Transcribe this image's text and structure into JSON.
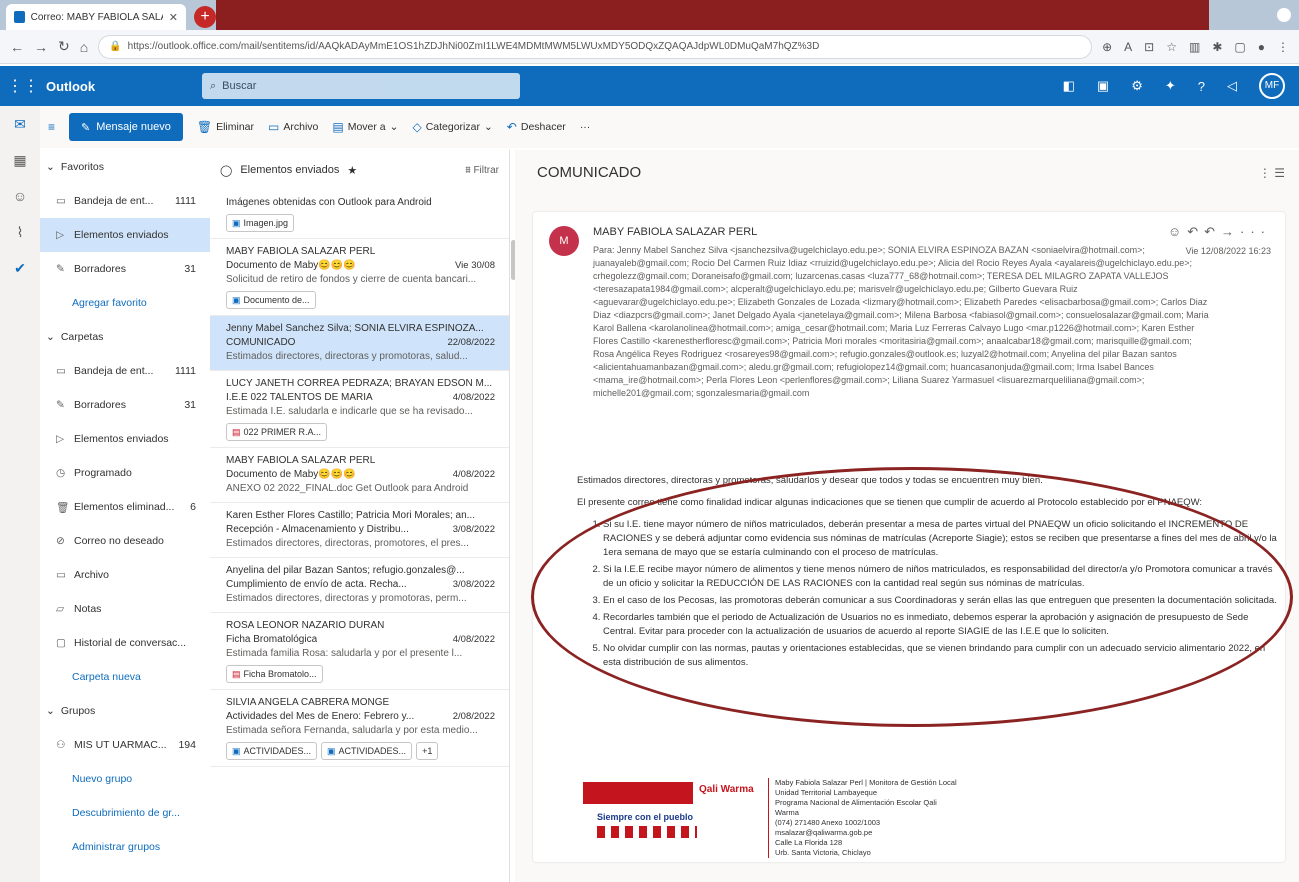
{
  "browser": {
    "tab_title": "Correo: MABY FABIOLA SALAZA",
    "url": "https://outlook.office.com/mail/sentitems/id/AAQkADAyMmE1OS1hZDJhNi00ZmI1LWE4MDMtMWM5LWUxMDY5ODQxZQAQAJdpWL0DMuQaM7hQZ%3D"
  },
  "outlook": {
    "brand": "Outlook",
    "search_placeholder": "Buscar",
    "avatar_initials": "MF"
  },
  "commands": {
    "new_message": "Mensaje nuevo",
    "delete": "Eliminar",
    "archive": "Archivo",
    "move": "Mover a",
    "categorize": "Categorizar",
    "undo": "Deshacer"
  },
  "folders": {
    "favorites_header": "Favoritos",
    "favorites": [
      {
        "label": "Bandeja de ent...",
        "count": "1111"
      },
      {
        "label": "Elementos enviados",
        "count": ""
      },
      {
        "label": "Borradores",
        "count": "31"
      }
    ],
    "add_favorite": "Agregar favorito",
    "folders_header": "Carpetas",
    "items": [
      {
        "label": "Bandeja de ent...",
        "count": "1111"
      },
      {
        "label": "Borradores",
        "count": "31"
      },
      {
        "label": "Elementos enviados",
        "count": ""
      },
      {
        "label": "Programado",
        "count": ""
      },
      {
        "label": "Elementos eliminad...",
        "count": "6"
      },
      {
        "label": "Correo no deseado",
        "count": ""
      },
      {
        "label": "Archivo",
        "count": ""
      },
      {
        "label": "Notas",
        "count": ""
      },
      {
        "label": "Historial de conversac...",
        "count": ""
      }
    ],
    "new_folder": "Carpeta nueva",
    "groups_header": "Grupos",
    "groups": [
      {
        "label": "MIS UT UARMAC...",
        "count": "194"
      }
    ],
    "new_group": "Nuevo grupo",
    "discover_groups": "Descubrimiento de gr...",
    "manage_groups": "Administrar grupos"
  },
  "list": {
    "title": "Elementos enviados",
    "filter": "Filtrar",
    "items": [
      {
        "sender": "",
        "subject": "Imágenes obtenidas con Outlook para Android",
        "date": "",
        "preview": "",
        "chips": [
          {
            "t": "Imagen.jpg",
            "k": "img"
          }
        ],
        "selected": false
      },
      {
        "sender": "MABY FABIOLA SALAZAR PERL",
        "subject": "Documento de Maby😊😊😊",
        "date": "Vie 30/08",
        "preview": "Solicitud de retiro de fondos y cierre de cuenta bancari...",
        "chips": [
          {
            "t": "Documento de...",
            "k": "img"
          }
        ],
        "selected": false
      },
      {
        "sender": "Jenny Mabel Sanchez Silva; SONIA ELVIRA ESPINOZA...",
        "subject": "COMUNICADO",
        "date": "22/08/2022",
        "preview": "Estimados directores, directoras y promotoras, salud...",
        "chips": [],
        "selected": true
      },
      {
        "sender": "LUCY JANETH CORREA PEDRAZA; BRAYAN EDSON M...",
        "subject": "I.E.E 022 TALENTOS DE MARIA",
        "date": "4/08/2022",
        "preview": "Estimada I.E. saludarla e indicarle que se ha revisado...",
        "chips": [
          {
            "t": "022 PRIMER R.A...",
            "k": "pdf"
          }
        ],
        "selected": false
      },
      {
        "sender": "MABY FABIOLA SALAZAR PERL",
        "subject": "Documento de Maby😊😊😊",
        "date": "4/08/2022",
        "preview": "ANEXO 02 2022_FINAL.doc Get Outlook para Android",
        "chips": [],
        "selected": false
      },
      {
        "sender": "Karen Esther Flores Castillo; Patricia Mori Morales; an...",
        "subject": "Recepción - Almacenamiento y Distribu...",
        "date": "3/08/2022",
        "preview": "Estimados directores, directoras, promotores, el pres...",
        "chips": [],
        "selected": false
      },
      {
        "sender": "Anyelina del pilar Bazan Santos; refugio.gonzales@...",
        "subject": "Cumplimiento de envío de acta. Recha...",
        "date": "3/08/2022",
        "preview": "Estimados directores, directoras y promotoras, perm...",
        "chips": [],
        "selected": false
      },
      {
        "sender": "ROSA LEONOR NAZARIO DURAN",
        "subject": "Ficha Bromatológica",
        "date": "4/08/2022",
        "preview": "Estimada familia Rosa: saludarla y por el presente l...",
        "chips": [
          {
            "t": "Ficha Bromatolo...",
            "k": "pdf"
          }
        ],
        "selected": false
      },
      {
        "sender": "SILVIA ANGELA CABRERA MONGE",
        "subject": "Actividades del Mes de Enero: Febrero y...",
        "date": "2/08/2022",
        "preview": "Estimada señora Fernanda, saludarla y por esta medio...",
        "chips": [
          {
            "t": "ACTIVIDADES...",
            "k": "img"
          },
          {
            "t": "ACTIVIDADES...",
            "k": "img"
          },
          {
            "t": "+1",
            "k": "none"
          }
        ],
        "selected": false
      }
    ]
  },
  "reading": {
    "subject": "COMUNICADO",
    "sender_initials": "M",
    "sender_name": "MABY FABIOLA SALAZAR PERL",
    "date": "Vie 12/08/2022 16:23",
    "recipients": "Para: Jenny Mabel Sanchez Silva <jsanchezsilva@ugelchiclayo.edu.pe>; SONIA ELVIRA ESPINOZA BAZAN <soniaelvira@hotmail.com>; juanayaleb@gmail.com; Rocio Del Carmen Ruiz Idiaz <rruizid@ugelchiclayo.edu.pe>; Alicia del Rocio Reyes Ayala <ayalareis@ugelchiclayo.edu.pe>; crhegolezz@gmail.com; Doraneisafo@gmail.com; luzarcenas.casas <luza777_68@hotmail.com>; TERESA DEL MILAGRO ZAPATA VALLEJOS <teresazapata1984@gmail.com>; alcperalt@ugelchiclayo.edu.pe; marisvelr@ugelchiclayo.edu.pe; Gilberto Guevara Ruiz <aguevarar@ugelchiclayo.edu.pe>; Elizabeth Gonzales de Lozada <lizmary@hotmail.com>; Elizabeth Paredes <elisacbarbosa@gmail.com>; Carlos Diaz Diaz <diazpcrs@gmail.com>; Janet Delgado Ayala <janetelaya@gmail.com>; Milena Barbosa <fabiasol@gmail.com>; consuelosalazar@gmail.com; Maria Karol Ballena <karolanolinea@hotmail.com>; amiga_cesar@hotmail.com; Maria Luz Ferreras Calvayo Lugo <mar.p1226@hotmail.com>; Karen Esther Flores Castillo <karenestherfloresc@gmail.com>; Patricia Mori morales <moritasiria@gmail.com>; anaalcabar18@gmail.com; marisquille@gmail.com; Rosa Angélica Reyes Rodriguez <rosareyes98@gmail.com>; refugio.gonzales@outlook.es; luzyal2@hotmail.com; Anyelina del pilar Bazan santos <alicientahuamanbazan@gmail.com>; aledu.gr@gmail.com; refugiolopez14@gmail.com; huancasanonjuda@gmail.com; Irma Isabel Bances <mama_ire@hotmail.com>; Perla Flores Leon <perlenflores@gmail.com>; Liliana Suarez Yarmasuel <lisuarezmarqueliliana@gmail.com>; michelle201@gmail.com; sgonzalesmaria@gmail.com",
    "greeting": "Estimados directores, directoras y promotoras, saludarlos y desear que todos y todas se encuentren muy bien.",
    "intro": "El presente correo tiene como finalidad indicar algunas indicaciones que se tienen que cumplir de acuerdo al Protocolo establecido por el PNAEQW:",
    "points": [
      "Si su I.E. tiene mayor número de niños matriculados, deberán presentar a mesa de partes virtual del PNAEQW un oficio solicitando el INCREMENTO DE RACIONES y se deberá adjuntar como evidencia sus nóminas de matrículas (Acreporte Siagie); estos se reciben que presentarse a fines del mes de abril y/o la 1era semana de mayo que se estaría culminando con el proceso de matrículas.",
      "Si la I.E.E recibe mayor número de alimentos y tiene menos número de niños matriculados, es responsabilidad del director/a y/o Promotora comunicar a través de un oficio y solicitar la REDUCCIÓN DE LAS RACIONES con la cantidad real según sus nóminas de matrículas.",
      "En el caso de los Pecosas, las promotoras deberán comunicar a sus Coordinadoras y serán ellas las que entreguen que presenten la documentación solicitada.",
      "Recordarles también que el periodo de Actualización de Usuarios no es inmediato, debemos esperar la aprobación y asignación de presupuesto de Sede Central. Evitar para proceder con la actualización de usuarios de acuerdo al reporte SIAGIE de las I.E.E que lo soliciten.",
      "No olvidar cumplir con las normas, pautas y orientaciones establecidas, que se vienen brindando para cumplir con un adecuado servicio alimentario 2022, en esta distribución de sus alimentos."
    ],
    "sig_logo_text": "Qali Warma",
    "sig_slogan": "Siempre con el pueblo",
    "sig_lines": [
      "Maby Fabiola Salazar Perl | Monitora de Gestión Local",
      "Unidad Territorial Lambayeque",
      "Programa Nacional de Alimentación Escolar Qali Warma",
      "(074) 271480 Anexo 1002/1003",
      "msalazar@qaliwarma.gob.pe",
      "Calle La Florida 128",
      "Urb. Santa Victoria, Chiclayo"
    ]
  }
}
